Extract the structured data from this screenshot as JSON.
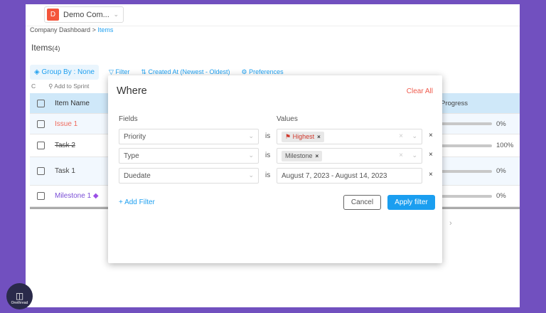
{
  "header": {
    "company_initial": "D",
    "company_name": "Demo Com..."
  },
  "breadcrumb": {
    "parent": "Company Dashboard",
    "separator": ">",
    "current": "Items"
  },
  "page": {
    "title": "Items",
    "count": "(4)"
  },
  "toolbar": {
    "group_by": "Group By : None",
    "filter": "Filter",
    "sort": "Created At (Newest - Oldest)",
    "preferences": "Preferences"
  },
  "actions": {
    "refresh": "C",
    "add_to_sprint": "Add to Sprint"
  },
  "table": {
    "headers": {
      "name": "Item Name",
      "progress": "Progress"
    },
    "rows": [
      {
        "name": "Issue 1",
        "progress": 0,
        "progress_label": "0%",
        "color": "#ef6a5c"
      },
      {
        "name": "Task 2",
        "progress": 100,
        "progress_label": "100%",
        "strike": true
      },
      {
        "name": "Task 1",
        "progress": 0,
        "progress_label": "0%"
      },
      {
        "name": "Milestone 1",
        "progress": 0,
        "progress_label": "0%",
        "color": "#7a4fd6"
      }
    ]
  },
  "modal": {
    "title": "Where",
    "clear_all": "Clear All",
    "fields_label": "Fields",
    "values_label": "Values",
    "is": "is",
    "filters": [
      {
        "field": "Priority",
        "value": "Highest"
      },
      {
        "field": "Type",
        "value": "Milestone"
      },
      {
        "field": "Duedate",
        "value": "August 7, 2023 - August 14, 2023"
      }
    ],
    "add_filter": "+ Add Filter",
    "cancel": "Cancel",
    "apply": "Apply filter"
  },
  "brand": {
    "name": "Onethread"
  },
  "colors": {
    "background": "#7150bf",
    "accent": "#1a9ef0",
    "danger": "#ef5a4c"
  }
}
